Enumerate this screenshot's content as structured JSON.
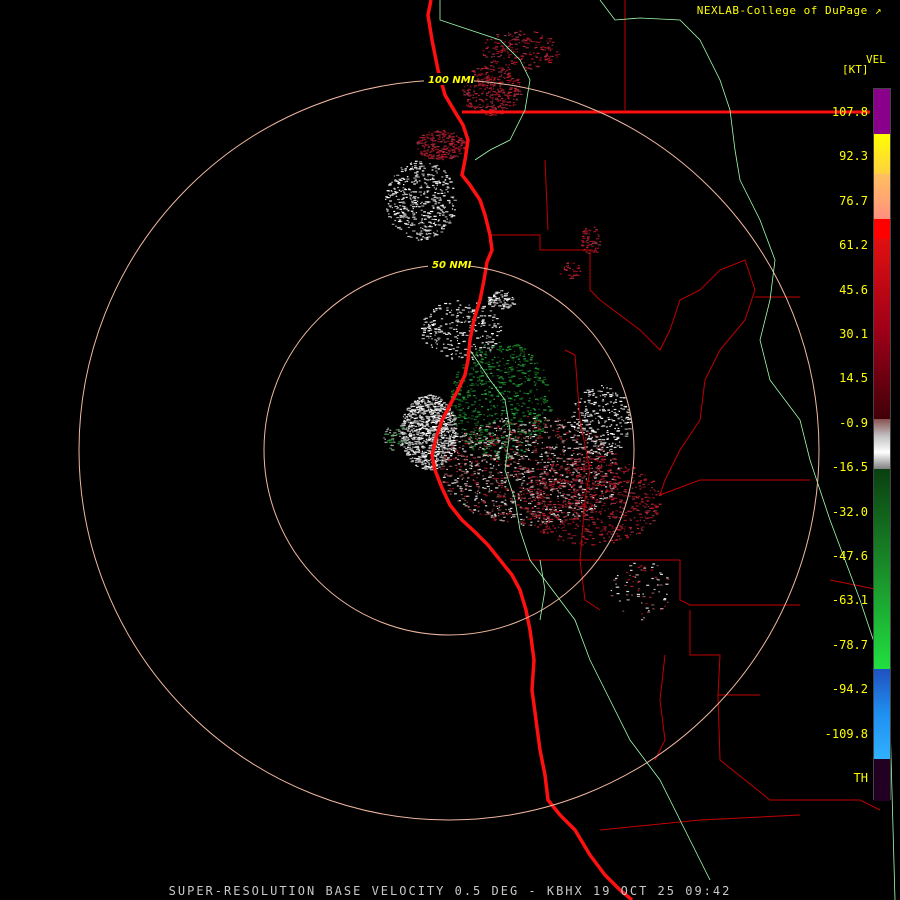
{
  "header": {
    "credit": "NEXLAB-College of DuPage",
    "credit_icon": "external-link-icon"
  },
  "legend": {
    "product": "VEL",
    "units": "[KT]",
    "ticks": [
      "107.8",
      "92.3",
      "76.7",
      "61.2",
      "45.6",
      "30.1",
      "14.5",
      "-0.9",
      "-16.5",
      "-32.0",
      "-47.6",
      "-63.1",
      "-78.7",
      "-94.2",
      "-109.8",
      "TH"
    ]
  },
  "rings": [
    {
      "label": "50 NMI"
    },
    {
      "label": "100 NMI"
    }
  ],
  "footer": "SUPER-RESOLUTION BASE VELOCITY 0.5 DEG - KBHX 19 OCT 25 09:42",
  "colors": {
    "background": "#000000",
    "range_ring": "#f0b8a0",
    "coastline": "#ff1010",
    "state_border": "#ff1010",
    "county_border": "#c00000",
    "river": "#a0ffb0",
    "label_yellow": "#ffff00",
    "inbound_green": "#1a8c2a",
    "outbound_red": "#a01020",
    "near_zero": "#d0d0d0"
  }
}
